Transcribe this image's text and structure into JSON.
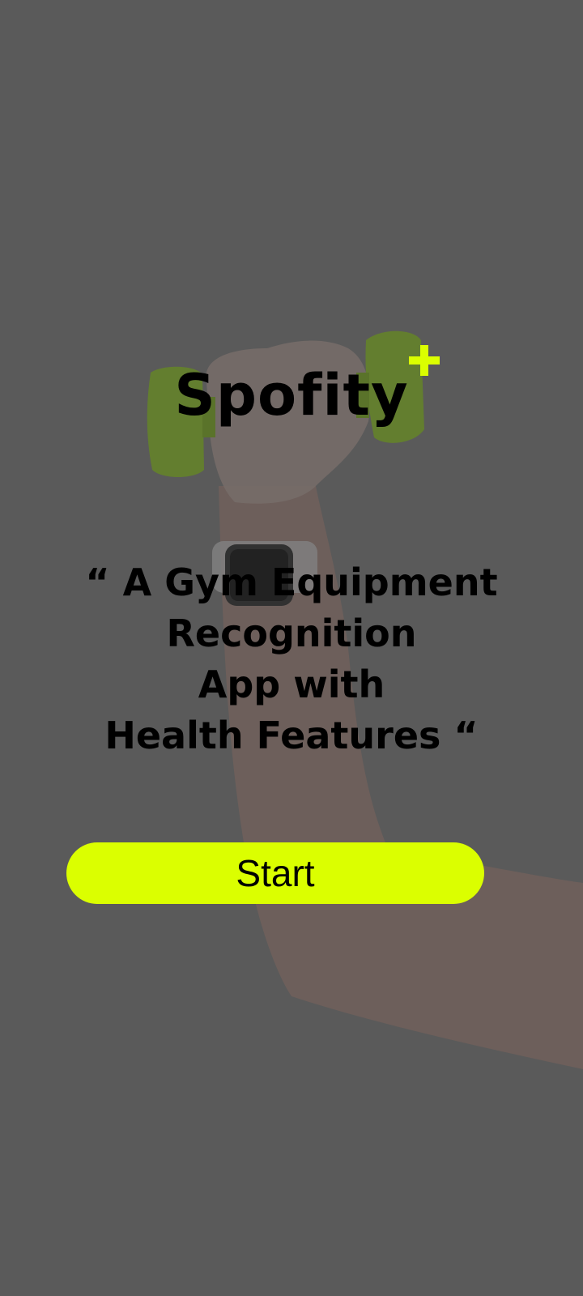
{
  "app": {
    "name": "Spofity",
    "logo_icon": "plus-icon"
  },
  "tagline": {
    "lines": [
      "“ A Gym Equipment",
      "Recognition",
      "App with",
      "Health Features “"
    ]
  },
  "actions": {
    "start_label": "Start"
  },
  "colors": {
    "accent": "#dbff00",
    "background": "#5e5e5e",
    "text": "#000000"
  }
}
